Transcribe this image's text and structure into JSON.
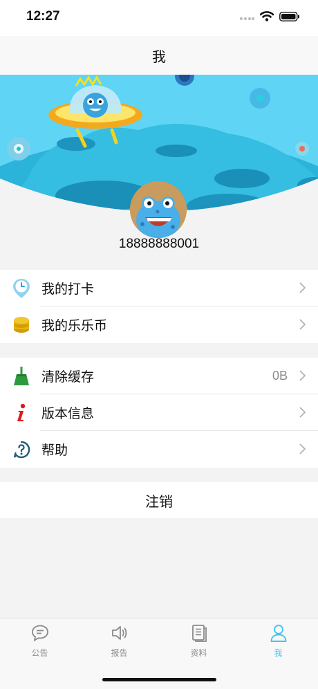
{
  "status_bar": {
    "time": "12:27"
  },
  "nav": {
    "title": "我"
  },
  "profile": {
    "phone": "18888888001"
  },
  "group1": [
    {
      "label": "我的打卡",
      "icon": "clock-pin-icon"
    },
    {
      "label": "我的乐乐币",
      "icon": "coin-stack-icon"
    }
  ],
  "group2": [
    {
      "label": "清除缓存",
      "icon": "broom-icon",
      "value": "0B"
    },
    {
      "label": "版本信息",
      "icon": "info-icon"
    },
    {
      "label": "帮助",
      "icon": "help-icon"
    }
  ],
  "logout": {
    "label": "注销"
  },
  "tabs": [
    {
      "label": "公告",
      "icon": "chat-bubble-icon",
      "active": false
    },
    {
      "label": "报告",
      "icon": "speaker-icon",
      "active": false
    },
    {
      "label": "资料",
      "icon": "document-icon",
      "active": false
    },
    {
      "label": "我",
      "icon": "person-icon",
      "active": true
    }
  ],
  "colors": {
    "accent": "#3ec7ee",
    "banner_sky": "#5ed3f5",
    "planet": "#2cb0d8",
    "coin": "#e8b50e",
    "broom": "#2e9a3e",
    "info": "#e11b1b",
    "help": "#1f5d78"
  }
}
